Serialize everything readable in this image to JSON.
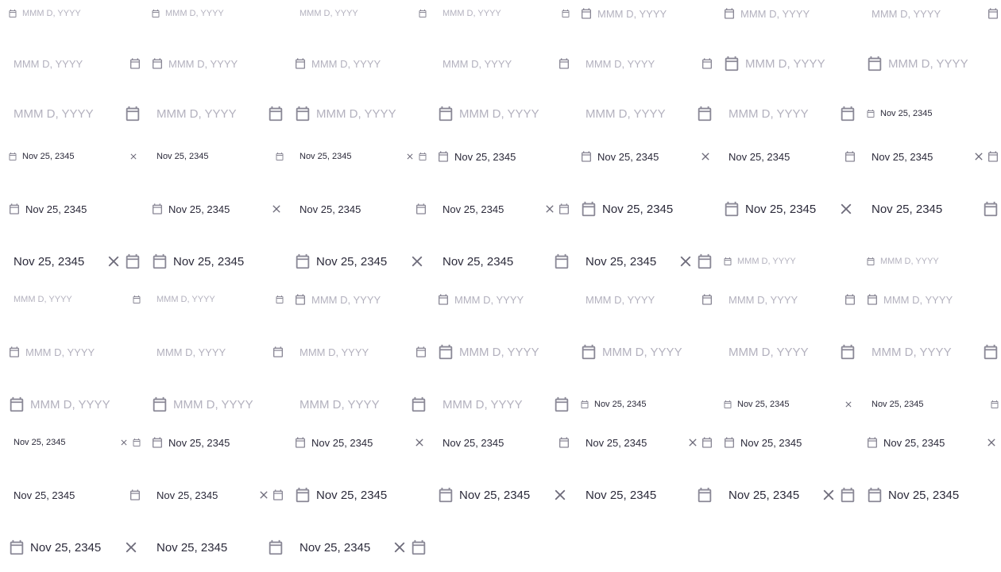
{
  "date_format_placeholder": "MMM D, YYYY",
  "selected_date": "Nov 25, 2345",
  "icons": {
    "calendar": "calendar-icon",
    "clear": "close-icon"
  },
  "colors": {
    "text": "#2b2a3a",
    "placeholder": "#b3b1be",
    "icon": "#8a8896"
  },
  "pickers": [
    {
      "size": "s",
      "icon": "left",
      "value": false,
      "clear": false
    },
    {
      "size": "s",
      "icon": "left",
      "value": false,
      "clear": false
    },
    {
      "size": "s",
      "icon": "right",
      "value": false,
      "clear": false
    },
    {
      "size": "s",
      "icon": "right",
      "value": false,
      "clear": false
    },
    {
      "size": "m",
      "icon": "left",
      "value": false,
      "clear": false
    },
    {
      "size": "m",
      "icon": "left",
      "value": false,
      "clear": false
    },
    {
      "size": "m",
      "icon": "right",
      "value": false,
      "clear": false
    },
    {
      "size": "m",
      "icon": "right",
      "value": false,
      "clear": false
    },
    {
      "size": "m",
      "icon": "left",
      "value": false,
      "clear": false
    },
    {
      "size": "m",
      "icon": "left",
      "value": false,
      "clear": false
    },
    {
      "size": "m",
      "icon": "right",
      "value": false,
      "clear": false
    },
    {
      "size": "m",
      "icon": "right",
      "value": false,
      "clear": false
    },
    {
      "size": "l",
      "icon": "left",
      "value": false,
      "clear": false
    },
    {
      "size": "l",
      "icon": "left",
      "value": false,
      "clear": false
    },
    {
      "size": "l",
      "icon": "right",
      "value": false,
      "clear": false
    },
    {
      "size": "l",
      "icon": "right",
      "value": false,
      "clear": false
    },
    {
      "size": "l",
      "icon": "left",
      "value": false,
      "clear": false
    },
    {
      "size": "l",
      "icon": "left",
      "value": false,
      "clear": false
    },
    {
      "size": "l",
      "icon": "right",
      "value": false,
      "clear": false
    },
    {
      "size": "l",
      "icon": "right",
      "value": false,
      "clear": false
    },
    {
      "size": "s",
      "icon": "left",
      "value": true,
      "clear": false
    },
    {
      "size": "s",
      "icon": "left",
      "value": true,
      "clear": true
    },
    {
      "size": "s",
      "icon": "right",
      "value": true,
      "clear": false
    },
    {
      "size": "s",
      "icon": "right",
      "value": true,
      "clear": true
    },
    {
      "size": "m",
      "icon": "left",
      "value": true,
      "clear": false
    },
    {
      "size": "m",
      "icon": "left",
      "value": true,
      "clear": true
    },
    {
      "size": "m",
      "icon": "right",
      "value": true,
      "clear": false
    },
    {
      "size": "m",
      "icon": "right",
      "value": true,
      "clear": true
    },
    {
      "size": "m",
      "icon": "left",
      "value": true,
      "clear": false
    },
    {
      "size": "m",
      "icon": "left",
      "value": true,
      "clear": true
    },
    {
      "size": "m",
      "icon": "right",
      "value": true,
      "clear": false
    },
    {
      "size": "m",
      "icon": "right",
      "value": true,
      "clear": true
    },
    {
      "size": "l",
      "icon": "left",
      "value": true,
      "clear": false
    },
    {
      "size": "l",
      "icon": "left",
      "value": true,
      "clear": true
    },
    {
      "size": "l",
      "icon": "right",
      "value": true,
      "clear": false
    },
    {
      "size": "l",
      "icon": "right",
      "value": true,
      "clear": true
    },
    {
      "size": "l",
      "icon": "left",
      "value": true,
      "clear": false
    },
    {
      "size": "l",
      "icon": "left",
      "value": true,
      "clear": true
    },
    {
      "size": "l",
      "icon": "right",
      "value": true,
      "clear": false
    },
    {
      "size": "l",
      "icon": "right",
      "value": true,
      "clear": true
    },
    {
      "size": "s",
      "icon": "left",
      "value": false,
      "clear": false
    },
    {
      "size": "s",
      "icon": "left",
      "value": false,
      "clear": false
    },
    {
      "size": "s",
      "icon": "right",
      "value": false,
      "clear": false
    },
    {
      "size": "s",
      "icon": "right",
      "value": false,
      "clear": false
    },
    {
      "size": "m",
      "icon": "left",
      "value": false,
      "clear": false
    },
    {
      "size": "m",
      "icon": "left",
      "value": false,
      "clear": false
    },
    {
      "size": "m",
      "icon": "right",
      "value": false,
      "clear": false
    },
    {
      "size": "m",
      "icon": "right",
      "value": false,
      "clear": false
    },
    {
      "size": "m",
      "icon": "left",
      "value": false,
      "clear": false
    },
    {
      "size": "m",
      "icon": "left",
      "value": false,
      "clear": false
    },
    {
      "size": "m",
      "icon": "right",
      "value": false,
      "clear": false
    },
    {
      "size": "m",
      "icon": "right",
      "value": false,
      "clear": false
    },
    {
      "size": "l",
      "icon": "left",
      "value": false,
      "clear": false
    },
    {
      "size": "l",
      "icon": "left",
      "value": false,
      "clear": false
    },
    {
      "size": "l",
      "icon": "right",
      "value": false,
      "clear": false
    },
    {
      "size": "l",
      "icon": "right",
      "value": false,
      "clear": false
    },
    {
      "size": "l",
      "icon": "left",
      "value": false,
      "clear": false
    },
    {
      "size": "l",
      "icon": "left",
      "value": false,
      "clear": false
    },
    {
      "size": "l",
      "icon": "right",
      "value": false,
      "clear": false
    },
    {
      "size": "l",
      "icon": "right",
      "value": false,
      "clear": false
    },
    {
      "size": "s",
      "icon": "left",
      "value": true,
      "clear": false
    },
    {
      "size": "s",
      "icon": "left",
      "value": true,
      "clear": true
    },
    {
      "size": "s",
      "icon": "right",
      "value": true,
      "clear": false
    },
    {
      "size": "s",
      "icon": "right",
      "value": true,
      "clear": true
    },
    {
      "size": "m",
      "icon": "left",
      "value": true,
      "clear": false
    },
    {
      "size": "m",
      "icon": "left",
      "value": true,
      "clear": true
    },
    {
      "size": "m",
      "icon": "right",
      "value": true,
      "clear": false
    },
    {
      "size": "m",
      "icon": "right",
      "value": true,
      "clear": true
    },
    {
      "size": "m",
      "icon": "left",
      "value": true,
      "clear": false
    },
    {
      "size": "m",
      "icon": "left",
      "value": true,
      "clear": true
    },
    {
      "size": "m",
      "icon": "right",
      "value": true,
      "clear": false
    },
    {
      "size": "m",
      "icon": "right",
      "value": true,
      "clear": true
    },
    {
      "size": "l",
      "icon": "left",
      "value": true,
      "clear": false
    },
    {
      "size": "l",
      "icon": "left",
      "value": true,
      "clear": true
    },
    {
      "size": "l",
      "icon": "right",
      "value": true,
      "clear": false
    },
    {
      "size": "l",
      "icon": "right",
      "value": true,
      "clear": true
    },
    {
      "size": "l",
      "icon": "left",
      "value": true,
      "clear": false
    },
    {
      "size": "l",
      "icon": "left",
      "value": true,
      "clear": true
    },
    {
      "size": "l",
      "icon": "right",
      "value": true,
      "clear": false
    },
    {
      "size": "l",
      "icon": "right",
      "value": true,
      "clear": true
    }
  ]
}
